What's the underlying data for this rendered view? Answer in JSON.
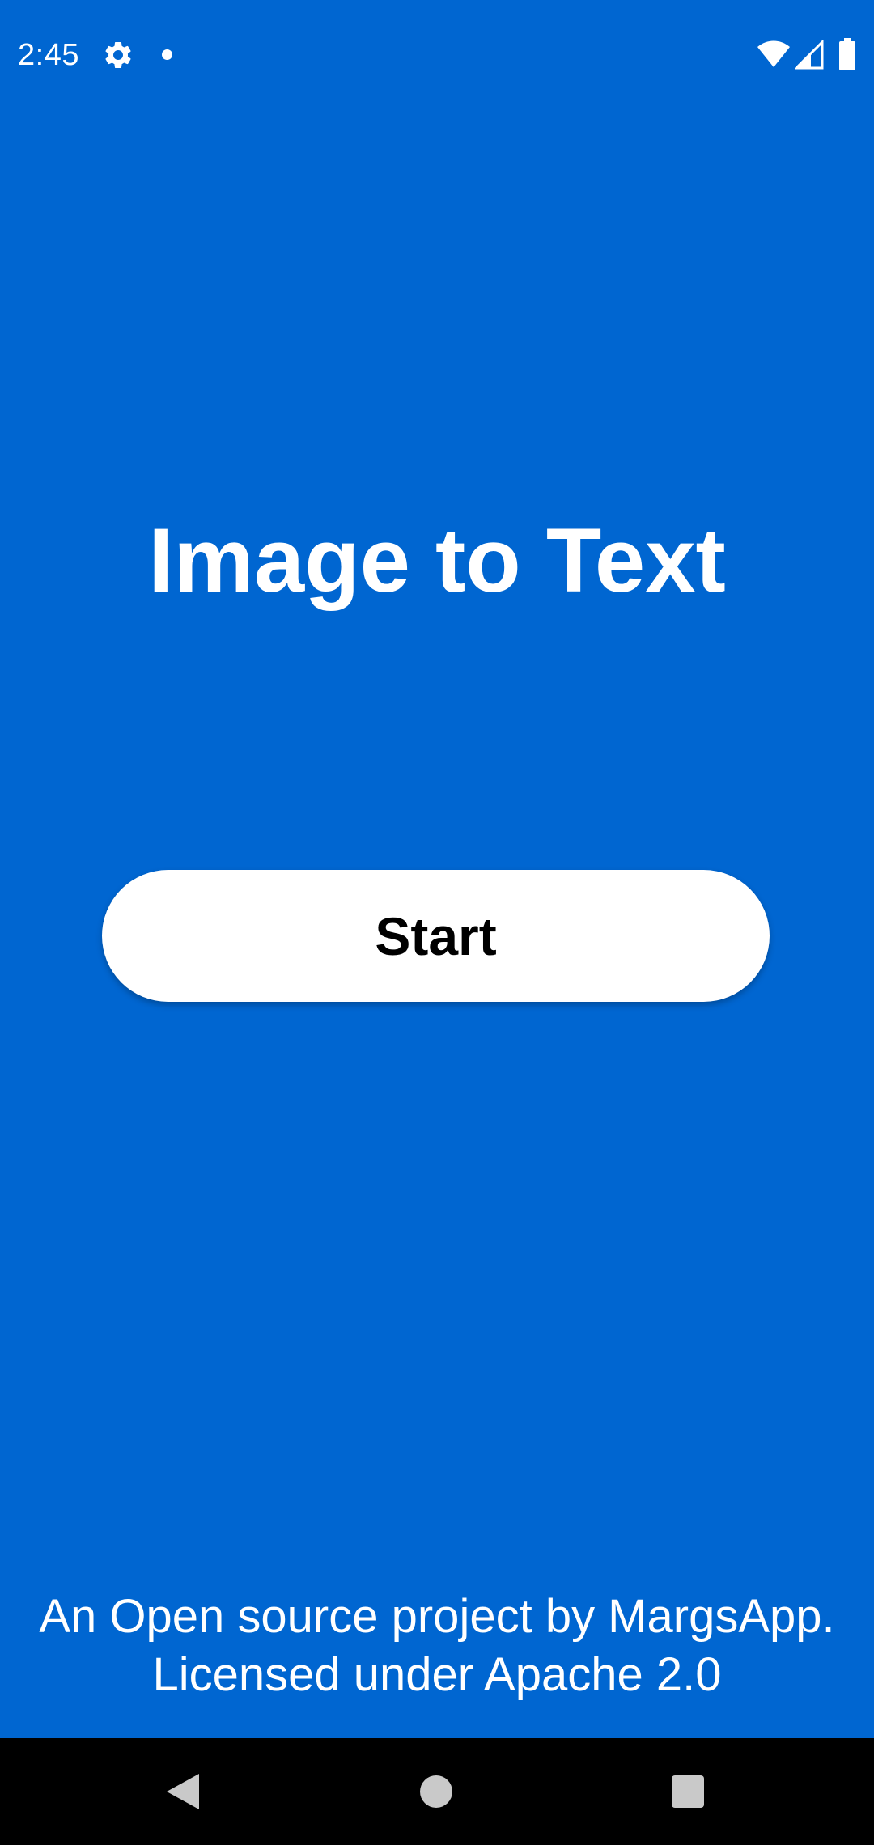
{
  "status_bar": {
    "time": "2:45",
    "icons": [
      "gear-icon",
      "notification-dot-icon",
      "wifi-icon",
      "cellular-signal-icon",
      "battery-icon"
    ]
  },
  "main": {
    "title": "Image to Text",
    "start_button_label": "Start"
  },
  "footer": {
    "line1": "An Open source project by MargsApp.",
    "line2": "Licensed under Apache 2.0"
  },
  "nav_bar": {
    "icons": [
      "back-icon",
      "home-icon",
      "recents-icon"
    ]
  },
  "colors": {
    "background": "#0066d1",
    "button": "#ffffff",
    "nav_bar": "#000000"
  }
}
